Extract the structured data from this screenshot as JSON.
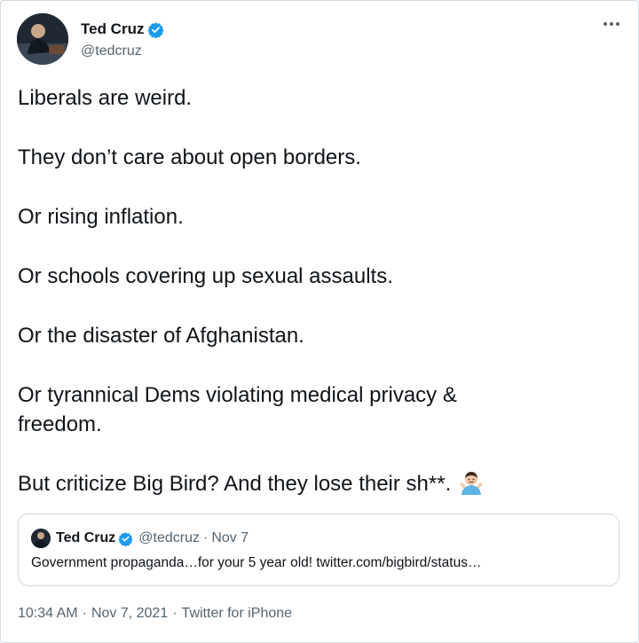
{
  "author": {
    "name": "Ted Cruz",
    "handle": "@tedcruz",
    "avatar_icon": "profile-photo",
    "verified_icon": "verified-badge-icon",
    "verified_color": "#1d9bf0"
  },
  "more_icon": "more-options-icon",
  "tweet": {
    "lines": [
      "Liberals are weird.",
      "They don’t care about open borders.",
      "Or rising inflation.",
      "Or schools covering up sexual assaults.",
      "Or the disaster of Afghanistan.",
      "Or tyrannical Dems violating medical privacy & freedom.",
      "But criticize Big Bird? And they lose their sh**."
    ],
    "emoji_icon": "person-shrugging-emoji"
  },
  "quote": {
    "name": "Ted Cruz",
    "handle": "@tedcruz",
    "separator": "·",
    "date": "Nov 7",
    "text": "Government propaganda…for your 5 year old! twitter.com/bigbird/status…"
  },
  "footer": {
    "time": "10:34 AM",
    "separator": "·",
    "date": "Nov 7, 2021",
    "source": "Twitter for iPhone"
  }
}
